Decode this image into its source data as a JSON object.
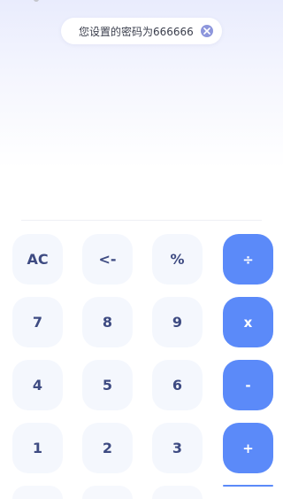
{
  "toast": {
    "message": "您设置的密码为666666",
    "close_icon": "close-circle-icon"
  },
  "keypad": {
    "rows": [
      [
        {
          "label": "AC",
          "type": "function"
        },
        {
          "label": "<-",
          "type": "function"
        },
        {
          "label": "%",
          "type": "function"
        },
        {
          "label": "÷",
          "type": "operator"
        }
      ],
      [
        {
          "label": "7",
          "type": "digit"
        },
        {
          "label": "8",
          "type": "digit"
        },
        {
          "label": "9",
          "type": "digit"
        },
        {
          "label": "x",
          "type": "operator"
        }
      ],
      [
        {
          "label": "4",
          "type": "digit"
        },
        {
          "label": "5",
          "type": "digit"
        },
        {
          "label": "6",
          "type": "digit"
        },
        {
          "label": "-",
          "type": "operator"
        }
      ],
      [
        {
          "label": "1",
          "type": "digit"
        },
        {
          "label": "2",
          "type": "digit"
        },
        {
          "label": "3",
          "type": "digit"
        },
        {
          "label": "+",
          "type": "operator"
        }
      ]
    ]
  },
  "colors": {
    "operator_key": "#5b8af9",
    "digit_key": "#f4f7fd",
    "key_text": "#3e4b82"
  }
}
